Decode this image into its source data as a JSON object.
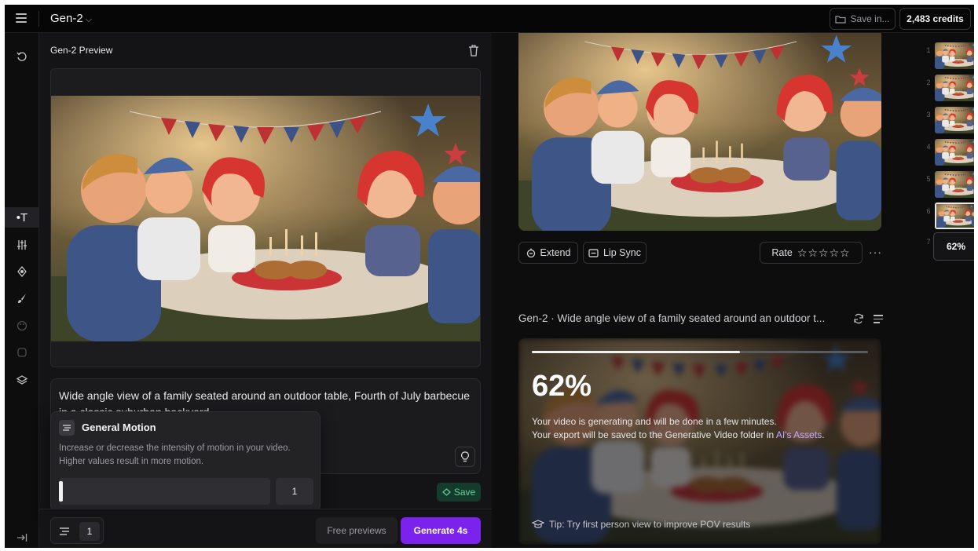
{
  "topbar": {
    "title": "Gen-2",
    "save_in_label": "Save in...",
    "credits_label": "2,483 credits",
    "icons": [
      "menu-icon",
      "chevron-down-icon",
      "folder-icon"
    ]
  },
  "rail": {
    "items": [
      "history-icon",
      "text-tool-icon",
      "sliders-icon",
      "camera-move-icon",
      "brush-icon",
      "palette-icon",
      "frame-icon",
      "layers-icon",
      "collapse-icon"
    ],
    "active_label": "T"
  },
  "left_panel": {
    "title": "Gen-2 Preview",
    "prompt_text": "Wide angle view of a family seated around an outdoor table, Fourth of July barbecue in a classic suburban backyard",
    "save_label": "Save"
  },
  "motion_popover": {
    "title": "General Motion",
    "description": "Increase or decrease the intensity of motion in your video. Higher values result in more motion.",
    "value": "1",
    "level_fraction": 0.0
  },
  "bottom_bar": {
    "motion_value": "1",
    "free_previews_label": "Free previews",
    "generate_label": "Generate 4s"
  },
  "video_actions": {
    "extend_label": "Extend",
    "lip_sync_label": "Lip Sync",
    "rate_label": "Rate",
    "rating_stars": "☆☆☆☆☆",
    "more_label": "···"
  },
  "generation": {
    "title": "Gen-2 · Wide angle view of a family seated around an outdoor t...",
    "progress_label": "62%",
    "progress_fraction": 0.62,
    "message_line1": "Your video is generating and will be done in a few minutes.",
    "message_line2_prefix": "Your export will be saved to the Generative Video folder in ",
    "message_link": "AI's Assets",
    "message_line2_suffix": ".",
    "tip": "Tip: Try first person view to improve POV results"
  },
  "thumbnails": {
    "numbers": [
      "1",
      "2",
      "3",
      "4",
      "5",
      "6",
      "7"
    ],
    "progress_label": "62%"
  },
  "colors": {
    "accent": "#7b22ec",
    "save_green": "#5fd69a",
    "link": "#c7a6ff"
  }
}
